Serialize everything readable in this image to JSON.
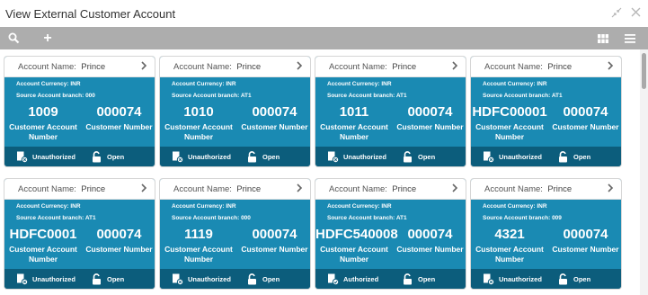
{
  "window": {
    "title": "View External Customer Account",
    "icons": [
      "minimize-icon",
      "close-icon"
    ]
  },
  "toolbar": {
    "add_label": "+",
    "icons": [
      "search-icon",
      "add-icon",
      "grid-view-icon",
      "list-view-icon"
    ]
  },
  "labels": {
    "account_name": "Account Name:",
    "currency": "Account Currency:",
    "branch": "Source Account branch:",
    "cust_acc_line1": "Customer Account",
    "cust_acc_line2": "Number",
    "cust_num": "Customer Number",
    "open": "Open"
  },
  "cards": [
    {
      "name": "Prince",
      "currency": "INR",
      "branch": "000",
      "account_number": "1009",
      "customer_number": "000074",
      "status": "Unauthorized"
    },
    {
      "name": "Prince",
      "currency": "INR",
      "branch": "AT1",
      "account_number": "1010",
      "customer_number": "000074",
      "status": "Unauthorized"
    },
    {
      "name": "Prince",
      "currency": "INR",
      "branch": "AT1",
      "account_number": "1011",
      "customer_number": "000074",
      "status": "Unauthorized"
    },
    {
      "name": "Prince",
      "currency": "INR",
      "branch": "AT1",
      "account_number": "HDFC00001",
      "customer_number": "000074",
      "status": "Unauthorized"
    },
    {
      "name": "Prince",
      "currency": "INR",
      "branch": "AT1",
      "account_number": "HDFC0001",
      "customer_number": "000074",
      "status": "Unauthorized"
    },
    {
      "name": "Prince",
      "currency": "INR",
      "branch": "000",
      "account_number": "1119",
      "customer_number": "000074",
      "status": "Unauthorized"
    },
    {
      "name": "Prince",
      "currency": "INR",
      "branch": "AT1",
      "account_number": "HDFC540008",
      "customer_number": "000074",
      "status": "Authorized"
    },
    {
      "name": "Prince",
      "currency": "INR",
      "branch": "009",
      "account_number": "4321",
      "customer_number": "000074",
      "status": "Unauthorized"
    }
  ],
  "colors": {
    "card_body": "#1a8ab3",
    "card_footer": "#0c5d7c",
    "toolbar": "#adadad"
  }
}
